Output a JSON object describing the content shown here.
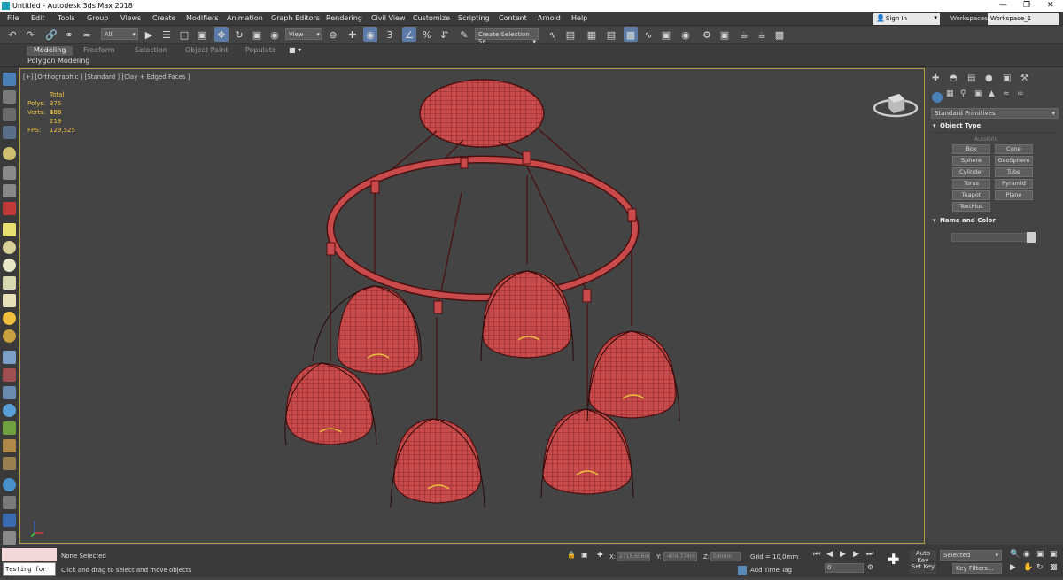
{
  "window": {
    "title": "Untitled - Autodesk 3ds Max 2018"
  },
  "menu": [
    "File",
    "Edit",
    "Tools",
    "Group",
    "Views",
    "Create",
    "Modifiers",
    "Animation",
    "Graph Editors",
    "Rendering",
    "Civil View",
    "Customize",
    "Scripting",
    "Content",
    "Arnold",
    "Help"
  ],
  "account": {
    "sign_in": "Sign In",
    "workspaces_label": "Workspaces:",
    "workspace": "Workspace_1"
  },
  "toolbar": {
    "filter": "All",
    "ref_coord": "View",
    "selection_set": "Create Selection Se"
  },
  "ribbon": {
    "tabs": [
      "Modeling",
      "Freeform",
      "Selection",
      "Object Paint",
      "Populate"
    ],
    "active": "Modeling",
    "sub": "Polygon Modeling"
  },
  "viewport": {
    "label": "[+] [Orthographic ] [Standard ] [Clay + Edged Faces ]",
    "stats": {
      "total_label": "Total",
      "polys_label": "Polys:",
      "polys": "375 408",
      "verts_label": "Verts:",
      "verts": "190 219",
      "fps_label": "FPS:",
      "fps": "129,525"
    }
  },
  "command_panel": {
    "dropdown": "Standard Primitives",
    "object_type": "Object Type",
    "autogrid": "AutoGrid",
    "buttons": [
      "Box",
      "Cone",
      "Sphere",
      "GeoSphere",
      "Cylinder",
      "Tube",
      "Torus",
      "Pyramid",
      "Teapot",
      "Plane",
      "TextPlus"
    ],
    "name_and_color": "Name and Color"
  },
  "status": {
    "maxscript": "Testing for :",
    "selection": "None Selected",
    "prompt": "Click and drag to select and move objects",
    "x_label": "X:",
    "x": "2715,656m",
    "y_label": "Y:",
    "y": "-404,774m",
    "z_label": "Z:",
    "z": "0,0mm",
    "grid": "Grid = 10,0mm",
    "add_time_tag": "Add Time Tag",
    "auto_key": "Auto Key",
    "set_key": "Set Key",
    "selected": "Selected",
    "key_filters": "Key Filters...",
    "frame": "0"
  },
  "colors": {
    "viewport_border": "#b89b45",
    "stats_text": "#f0c040",
    "mesh": "#c84a4a",
    "wire": "#4a1010",
    "active_tool": "#5d7ba8"
  }
}
